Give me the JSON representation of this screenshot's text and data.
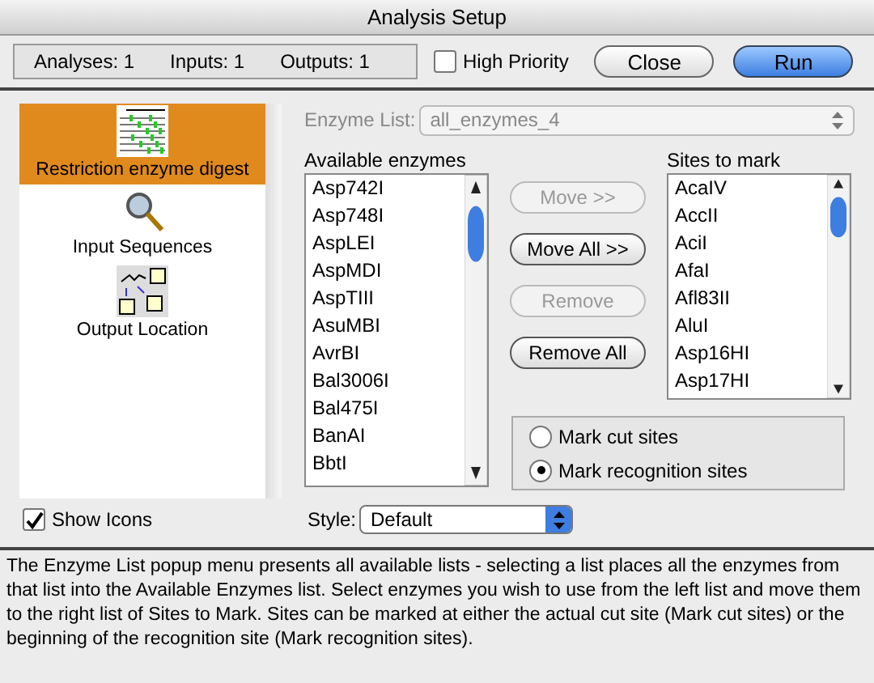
{
  "window": {
    "title": "Analysis Setup"
  },
  "counts": [
    "Analyses: 1",
    "Inputs: 1",
    "Outputs: 1"
  ],
  "high_priority": {
    "label": "High Priority",
    "checked": false
  },
  "buttons": [
    {
      "label": "Close",
      "kind": "normal"
    },
    {
      "label": "Run",
      "kind": "default"
    }
  ],
  "sidebar": {
    "items": [
      {
        "label": "Restriction enzyme digest",
        "kind": "digest",
        "selected": true
      },
      {
        "label": "Input Sequences",
        "kind": "sequences",
        "selected": false
      },
      {
        "label": "Output Location",
        "kind": "output",
        "selected": false
      }
    ]
  },
  "enzyme_list": {
    "label": "Enzyme List:",
    "value": "all_enzymes_4",
    "disabled": true
  },
  "available": {
    "heading": "Available enzymes",
    "items": [
      "Asp742I",
      "Asp748I",
      "AspLEI",
      "AspMDI",
      "AspTIII",
      "AsuMBI",
      "AvrBI",
      "Bal3006I",
      "Bal475I",
      "BanAI",
      "BbtI"
    ]
  },
  "move_buttons": [
    {
      "label": "Move >>",
      "disabled": true
    },
    {
      "label": "Move All >>",
      "disabled": false
    },
    {
      "label": "Remove",
      "disabled": true
    },
    {
      "label": "Remove All",
      "disabled": false
    }
  ],
  "sites": {
    "heading": "Sites to mark",
    "items": [
      "AcaIV",
      "AccII",
      "AciI",
      "AfaI",
      "Afl83II",
      "AluI",
      "Asp16HI",
      "Asp17HI"
    ]
  },
  "mark_options": [
    {
      "label": "Mark cut sites",
      "selected": false
    },
    {
      "label": "Mark recognition sites",
      "selected": true
    }
  ],
  "show_icons": {
    "label": "Show Icons",
    "checked": true
  },
  "style": {
    "label": "Style:",
    "value": "Default"
  },
  "help_text": "The Enzyme List popup menu presents all available lists - selecting a list places all the enzymes from that list into the Available Enzymes list. Select enzymes you wish to use from the left list and move them to the right list of Sites to Mark. Sites can be marked at either the actual cut site (Mark cut sites) or the beginning of the recognition site (Mark recognition sites)."
}
